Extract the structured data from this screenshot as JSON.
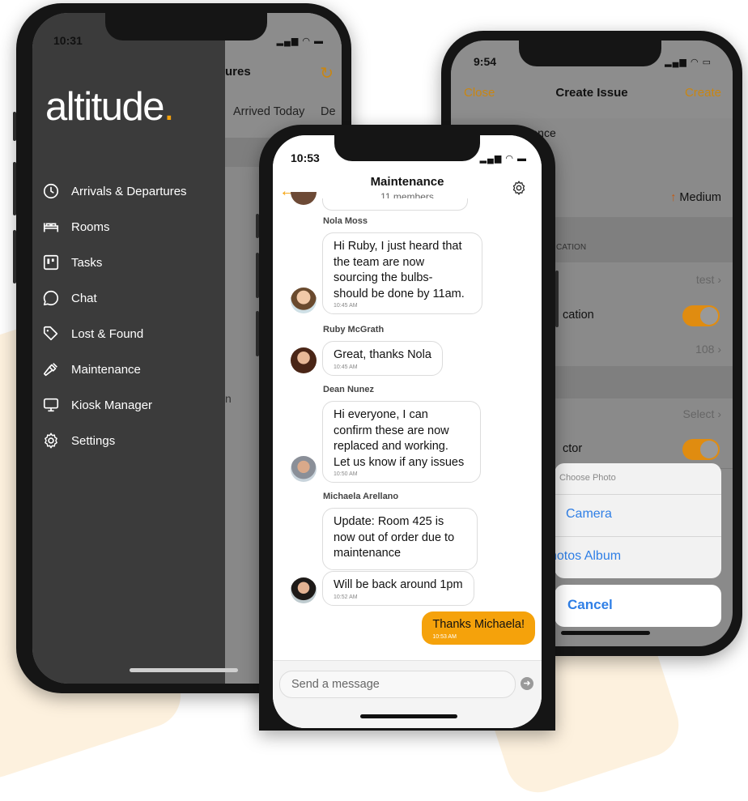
{
  "phone1": {
    "time": "10:31",
    "logo_text": "altitude",
    "logo_dot": ".",
    "bg_title": "ures",
    "bg_tab_active": "Arrived Today",
    "bg_tab_next": "De",
    "bg_fragment": "n",
    "menu": [
      {
        "label": "Arrivals & Departures",
        "icon": "clock-icon"
      },
      {
        "label": "Rooms",
        "icon": "bed-icon"
      },
      {
        "label": "Tasks",
        "icon": "kanban-icon"
      },
      {
        "label": "Chat",
        "icon": "chat-bubble-icon"
      },
      {
        "label": "Lost & Found",
        "icon": "tag-icon"
      },
      {
        "label": "Maintenance",
        "icon": "hammer-icon"
      },
      {
        "label": "Kiosk Manager",
        "icon": "monitor-icon"
      },
      {
        "label": "Settings",
        "icon": "gear-icon"
      }
    ]
  },
  "phone2": {
    "time": "10:53",
    "title": "Maintenance",
    "subtitle": "11 members",
    "messages": [
      {
        "sender": "Nola Moss",
        "text": [
          "Hi Ruby, I just heard that",
          "the team are now",
          "sourcing the bulbs-",
          "should be done by 11am."
        ],
        "time": "10:45 AM"
      },
      {
        "sender": "Ruby McGrath",
        "text": [
          "Great, thanks Nola"
        ],
        "time": "10:45 AM"
      },
      {
        "sender": "Dean Nunez",
        "text": [
          "Hi everyone, I can",
          "confirm these are now",
          "replaced and working.",
          "Let us know if any issues"
        ],
        "time": "10:50 AM"
      },
      {
        "sender": "Michaela Arellano",
        "text": [
          "Update: Room 425 is",
          "now out of order due to",
          "maintenance"
        ],
        "time": ""
      },
      {
        "sender": "",
        "text": [
          "Will be back around 1pm"
        ],
        "time": "10:52 AM"
      }
    ],
    "my_message": {
      "text": "Thanks Michaela!",
      "time": "10:53 AM"
    },
    "input_placeholder": "Send a message"
  },
  "phone3": {
    "time": "9:54",
    "close": "Close",
    "title": "Create Issue",
    "create": "Create",
    "issue_name": "Test Maintenance",
    "priority": "Medium",
    "section_location": "CATION",
    "location_value": "test",
    "location_toggle_label": "cation",
    "room_value": "108",
    "select_value": "Select",
    "contractor_label": "ctor",
    "sheet_title": "Choose Photo",
    "sheet_camera": "Camera",
    "sheet_album": "hotos Album",
    "sheet_cancel": "Cancel"
  },
  "colors": {
    "accent": "#f5a20b",
    "drawer": "#3b3b3b",
    "ios_blue": "#2f7fe6"
  }
}
